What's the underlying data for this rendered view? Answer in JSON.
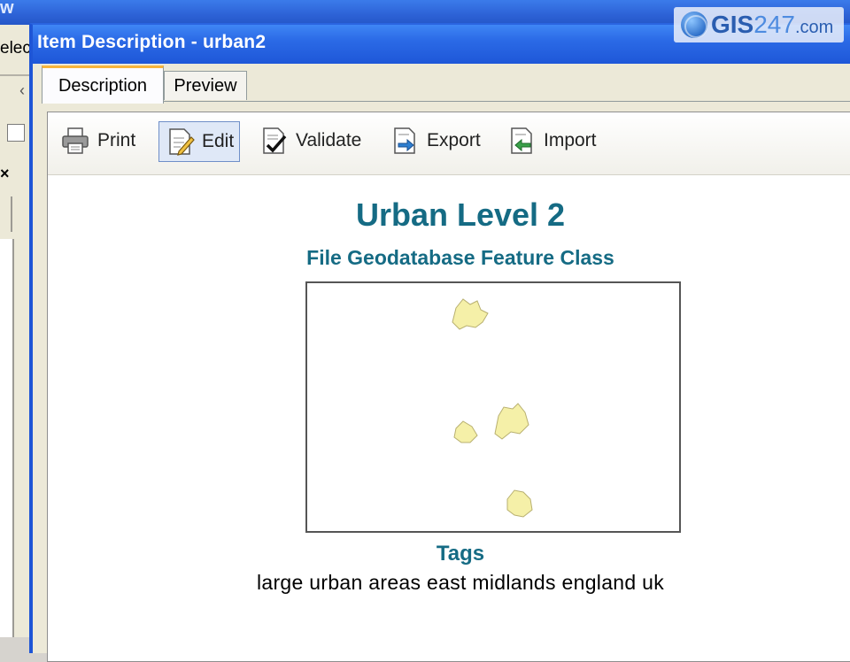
{
  "background": {
    "title_fragment": "w",
    "menu_fragment": "elect"
  },
  "watermark": {
    "brand_bold": "GIS",
    "brand_num": "247",
    "brand_tld": ".com"
  },
  "dialog": {
    "title": "Item Description - urban2",
    "tabs": [
      {
        "label": "Description",
        "active": true
      },
      {
        "label": "Preview",
        "active": false
      }
    ],
    "toolbar": {
      "print": "Print",
      "edit": "Edit",
      "validate": "Validate",
      "export": "Export",
      "import": "Import"
    },
    "description": {
      "title": "Urban Level 2",
      "subtitle": "File Geodatabase Feature Class",
      "tags_heading": "Tags",
      "tags": "large urban areas east midlands england uk"
    }
  },
  "colors": {
    "titlebar": "#2b6ae6",
    "heading": "#156b84",
    "polygon_fill": "#f5f0a8"
  },
  "icons": {
    "print": "printer-icon",
    "edit": "edit-document-icon",
    "validate": "validate-check-icon",
    "export": "export-icon",
    "import": "import-icon",
    "cursor": "mouse-pointer-icon"
  }
}
